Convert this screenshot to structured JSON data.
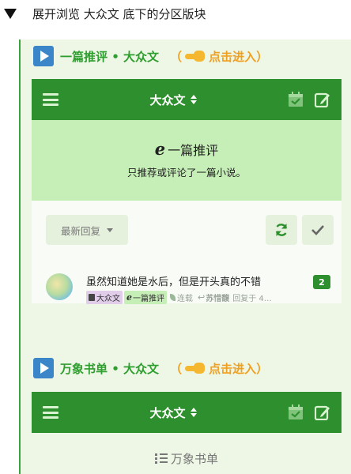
{
  "header": {
    "title": "展开浏览 大众文 底下的分区版块"
  },
  "sections": [
    {
      "title": "一篇推评 • 大众文",
      "enter_open": "（",
      "enter_label": "点击进入）",
      "bar_title": "大众文",
      "forum_name": "一篇推评",
      "forum_desc": "只推荐或评论了一篇小说。",
      "sort_label": "最新回复",
      "thread": {
        "title": "虽然知道她是水后，但是开头真的不错",
        "count": "2",
        "tag_channel": "大众文",
        "tag_forum": "一篇推评",
        "status": "连载",
        "author": "苏惜馥",
        "reply_text": "回复于 4…"
      }
    },
    {
      "title": "万象书单 • 大众文",
      "enter_open": "（",
      "enter_label": "点击进入）",
      "bar_title": "大众文",
      "forum_name": "万象书单"
    }
  ],
  "colors": {
    "accent": "#2e8f2e",
    "title_green": "#2e9e2e",
    "enter_orange": "#f0a020",
    "panel_bg": "#eef7e6",
    "forum_bg": "#c6efb7"
  },
  "icons": [
    "play-icon",
    "pointing-hand-icon",
    "menu-icon",
    "sort-icon",
    "calendar-check-icon",
    "edit-icon",
    "refresh-icon",
    "check-icon",
    "book-icon",
    "ie-icon",
    "leaf-icon",
    "reply-icon",
    "list-icon"
  ]
}
